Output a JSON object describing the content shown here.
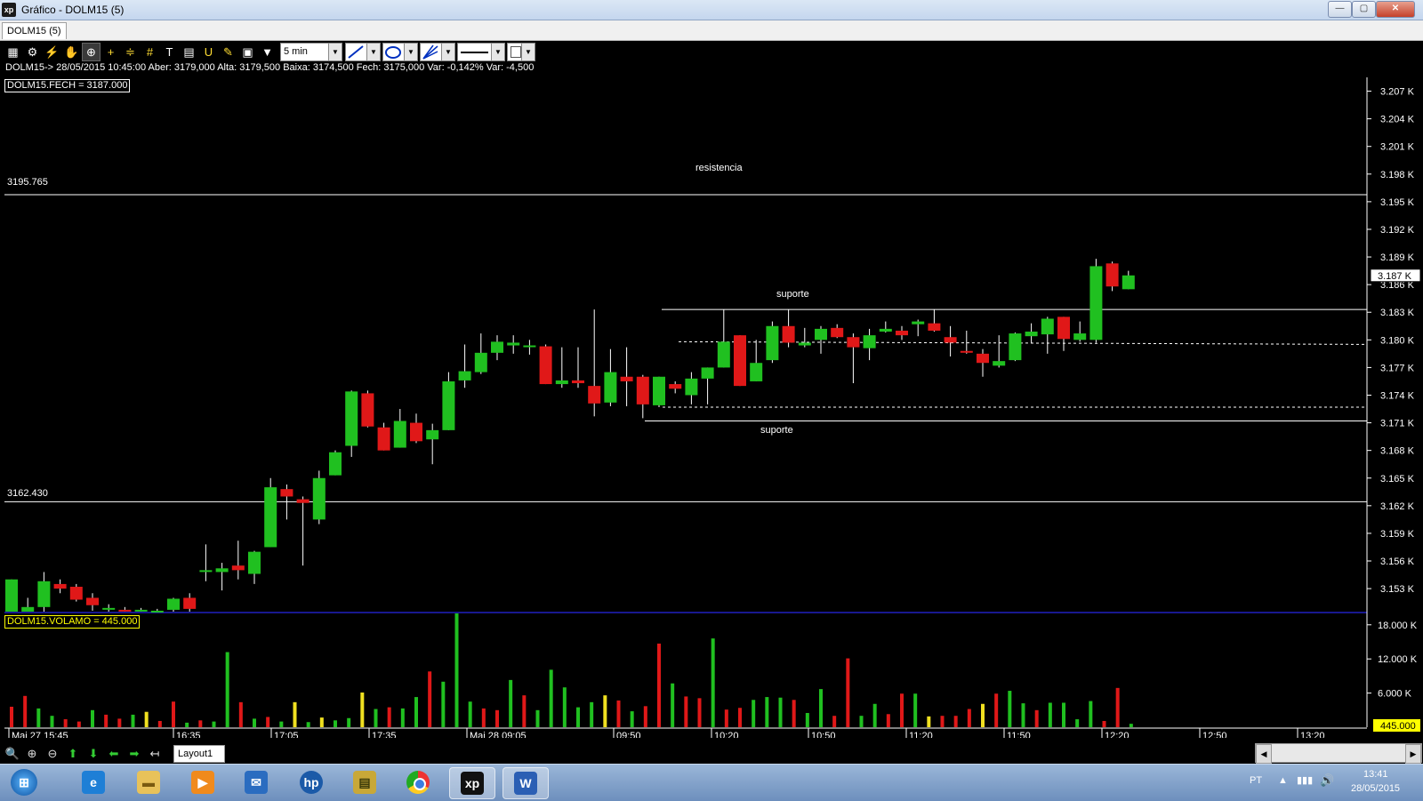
{
  "window": {
    "title": "Gráfico - DOLM15 (5)",
    "app_icon_text": "xp",
    "minimize_label": "—",
    "restore_label": "▢",
    "close_label": "✕"
  },
  "tabs": [
    {
      "label": "DOLM15 (5)"
    }
  ],
  "toolbar": {
    "timeframe": "5 min",
    "icons": [
      "chart-type-icon",
      "settings-gear-icon",
      "indicator-icon",
      "hand-pan-icon",
      "crosshair-icon",
      "cursor-icon",
      "fibonacci-icon",
      "grid-icon",
      "text-tool-icon",
      "calculator-icon",
      "magnet-icon",
      "order-icon",
      "clipboard-icon",
      "filter-icon"
    ]
  },
  "info_line": "DOLM15-> 28/05/2015 10:45:00 Aber: 3179,000 Alta: 3179,500 Baixa: 3174,500 Fech: 3175,000 Var: -0,142% Var: -4,500",
  "price_legend": "DOLM15.FECH = 3187.000",
  "volume_legend": "DOLM15.VOLAMO = 445.000",
  "annotations": {
    "resistencia": "resistencia",
    "suporte_upper": "suporte",
    "suporte_lower": "suporte",
    "level_high": "3195.765",
    "level_low": "3162.430"
  },
  "price_axis": {
    "ticks": [
      "3.207 K",
      "3.204 K",
      "3.201 K",
      "3.198 K",
      "3.195 K",
      "3.192 K",
      "3.189 K",
      "3.186 K",
      "3.183 K",
      "3.180 K",
      "3.177 K",
      "3.174 K",
      "3.171 K",
      "3.168 K",
      "3.165 K",
      "3.162 K",
      "3.159 K",
      "3.156 K",
      "3.153 K"
    ],
    "current": "3.187 K"
  },
  "volume_axis": {
    "ticks": [
      "18.000 K",
      "12.000 K",
      "6.000 K"
    ],
    "current": "445.000"
  },
  "time_axis": [
    "Mai 27 15:45",
    "16:35",
    "17:05",
    "17:35",
    "Mai 28 09:05",
    "09:50",
    "10:20",
    "10:50",
    "11:20",
    "11:50",
    "12:20",
    "12:50",
    "13:20"
  ],
  "chart_data": {
    "type": "candlestick",
    "symbol": "DOLM15",
    "timeframe": "5 min",
    "price_range": [
      3150.5,
      3208.5
    ],
    "volume_range": [
      0,
      20000
    ],
    "horizontal_lines": [
      {
        "label": "resistencia",
        "price": 3195.765
      },
      {
        "label": "suporte",
        "price": 3183.3
      },
      {
        "label": "suporte",
        "price": 3171.2
      },
      {
        "label": "",
        "price": 3162.43
      }
    ],
    "dotted_lines": [
      3179.8,
      3172.7
    ],
    "candles": [
      {
        "o": 3150.5,
        "h": 3154.0,
        "l": 3150.5,
        "c": 3154.0
      },
      {
        "o": 3150.5,
        "h": 3152.0,
        "l": 3150.5,
        "c": 3151.0
      },
      {
        "o": 3151.0,
        "h": 3154.8,
        "l": 3150.5,
        "c": 3153.8
      },
      {
        "o": 3153.5,
        "h": 3154.0,
        "l": 3152.5,
        "c": 3153.0
      },
      {
        "o": 3153.2,
        "h": 3153.5,
        "l": 3151.6,
        "c": 3151.8
      },
      {
        "o": 3152.0,
        "h": 3152.5,
        "l": 3150.6,
        "c": 3151.2
      },
      {
        "o": 3150.8,
        "h": 3151.3,
        "l": 3150.5,
        "c": 3150.9
      },
      {
        "o": 3150.7,
        "h": 3151.0,
        "l": 3150.5,
        "c": 3150.6
      },
      {
        "o": 3150.6,
        "h": 3150.9,
        "l": 3150.5,
        "c": 3150.7
      },
      {
        "o": 3150.6,
        "h": 3150.8,
        "l": 3150.5,
        "c": 3150.6
      },
      {
        "o": 3150.7,
        "h": 3152.0,
        "l": 3150.5,
        "c": 3151.9
      },
      {
        "o": 3152.0,
        "h": 3152.5,
        "l": 3150.5,
        "c": 3150.8
      },
      {
        "o": 3155.0,
        "h": 3157.8,
        "l": 3153.8,
        "c": 3155.0
      },
      {
        "o": 3154.8,
        "h": 3155.8,
        "l": 3152.8,
        "c": 3155.2
      },
      {
        "o": 3155.5,
        "h": 3158.2,
        "l": 3154.0,
        "c": 3155.0
      },
      {
        "o": 3154.6,
        "h": 3157.1,
        "l": 3153.5,
        "c": 3157.0
      },
      {
        "o": 3157.5,
        "h": 3165.0,
        "l": 3157.5,
        "c": 3164.0
      },
      {
        "o": 3163.8,
        "h": 3164.3,
        "l": 3160.5,
        "c": 3163.0
      },
      {
        "o": 3162.7,
        "h": 3163.0,
        "l": 3155.5,
        "c": 3162.3
      },
      {
        "o": 3160.5,
        "h": 3165.8,
        "l": 3160.0,
        "c": 3165.0
      },
      {
        "o": 3165.3,
        "h": 3168.0,
        "l": 3165.3,
        "c": 3167.8
      },
      {
        "o": 3168.5,
        "h": 3174.5,
        "l": 3167.3,
        "c": 3174.4
      },
      {
        "o": 3174.2,
        "h": 3174.5,
        "l": 3170.5,
        "c": 3170.6
      },
      {
        "o": 3170.5,
        "h": 3171.0,
        "l": 3168.0,
        "c": 3168.0
      },
      {
        "o": 3168.3,
        "h": 3172.5,
        "l": 3168.3,
        "c": 3171.2
      },
      {
        "o": 3171.0,
        "h": 3172.0,
        "l": 3168.8,
        "c": 3169.0
      },
      {
        "o": 3169.2,
        "h": 3170.9,
        "l": 3166.5,
        "c": 3170.2
      },
      {
        "o": 3170.2,
        "h": 3176.5,
        "l": 3170.2,
        "c": 3175.5
      },
      {
        "o": 3175.6,
        "h": 3179.5,
        "l": 3174.8,
        "c": 3176.6
      },
      {
        "o": 3176.5,
        "h": 3180.7,
        "l": 3176.3,
        "c": 3178.6
      },
      {
        "o": 3178.6,
        "h": 3180.5,
        "l": 3177.8,
        "c": 3179.8
      },
      {
        "o": 3179.4,
        "h": 3180.5,
        "l": 3178.5,
        "c": 3179.7
      },
      {
        "o": 3179.3,
        "h": 3180.0,
        "l": 3178.4,
        "c": 3179.4
      },
      {
        "o": 3179.3,
        "h": 3179.5,
        "l": 3175.2,
        "c": 3175.2
      },
      {
        "o": 3175.2,
        "h": 3179.2,
        "l": 3174.8,
        "c": 3175.6
      },
      {
        "o": 3175.6,
        "h": 3179.2,
        "l": 3174.8,
        "c": 3175.3
      },
      {
        "o": 3175.0,
        "h": 3183.3,
        "l": 3171.7,
        "c": 3173.1
      },
      {
        "o": 3173.2,
        "h": 3179.0,
        "l": 3172.8,
        "c": 3176.5
      },
      {
        "o": 3176.0,
        "h": 3179.2,
        "l": 3172.8,
        "c": 3175.5
      },
      {
        "o": 3176.0,
        "h": 3176.2,
        "l": 3171.5,
        "c": 3173.0
      },
      {
        "o": 3172.9,
        "h": 3176.0,
        "l": 3172.7,
        "c": 3176.0
      },
      {
        "o": 3175.2,
        "h": 3175.5,
        "l": 3174.2,
        "c": 3174.7
      },
      {
        "o": 3174.0,
        "h": 3176.5,
        "l": 3173.0,
        "c": 3175.8
      },
      {
        "o": 3175.8,
        "h": 3177.0,
        "l": 3173.0,
        "c": 3177.0
      },
      {
        "o": 3177.0,
        "h": 3183.3,
        "l": 3177.0,
        "c": 3179.8
      },
      {
        "o": 3180.5,
        "h": 3180.5,
        "l": 3175.0,
        "c": 3175.0
      },
      {
        "o": 3175.5,
        "h": 3180.0,
        "l": 3175.5,
        "c": 3177.5
      },
      {
        "o": 3177.8,
        "h": 3182.0,
        "l": 3177.5,
        "c": 3181.5
      },
      {
        "o": 3181.5,
        "h": 3183.3,
        "l": 3179.2,
        "c": 3179.7
      },
      {
        "o": 3179.4,
        "h": 3181.3,
        "l": 3179.2,
        "c": 3179.7
      },
      {
        "o": 3180.0,
        "h": 3181.5,
        "l": 3178.5,
        "c": 3181.2
      },
      {
        "o": 3181.3,
        "h": 3181.7,
        "l": 3180.2,
        "c": 3180.3
      },
      {
        "o": 3180.3,
        "h": 3180.7,
        "l": 3175.3,
        "c": 3179.2
      },
      {
        "o": 3179.1,
        "h": 3181.2,
        "l": 3177.8,
        "c": 3180.5
      },
      {
        "o": 3180.9,
        "h": 3182.0,
        "l": 3180.8,
        "c": 3181.2
      },
      {
        "o": 3181.0,
        "h": 3181.5,
        "l": 3180.0,
        "c": 3180.5
      },
      {
        "o": 3181.7,
        "h": 3182.2,
        "l": 3180.4,
        "c": 3182.0
      },
      {
        "o": 3181.8,
        "h": 3183.3,
        "l": 3180.9,
        "c": 3181.0
      },
      {
        "o": 3180.3,
        "h": 3181.5,
        "l": 3178.2,
        "c": 3179.7
      },
      {
        "o": 3178.8,
        "h": 3181.0,
        "l": 3178.5,
        "c": 3178.7
      },
      {
        "o": 3178.5,
        "h": 3179.0,
        "l": 3176.0,
        "c": 3177.5
      },
      {
        "o": 3177.2,
        "h": 3180.5,
        "l": 3177.0,
        "c": 3177.7
      },
      {
        "o": 3177.8,
        "h": 3180.8,
        "l": 3177.7,
        "c": 3180.7
      },
      {
        "o": 3180.4,
        "h": 3181.8,
        "l": 3179.6,
        "c": 3180.9
      },
      {
        "o": 3180.6,
        "h": 3182.5,
        "l": 3178.5,
        "c": 3182.3
      },
      {
        "o": 3182.5,
        "h": 3182.5,
        "l": 3178.8,
        "c": 3180.1
      },
      {
        "o": 3180.0,
        "h": 3182.0,
        "l": 3179.8,
        "c": 3180.7
      },
      {
        "o": 3180.0,
        "h": 3188.8,
        "l": 3179.7,
        "c": 3188.0
      },
      {
        "o": 3188.3,
        "h": 3188.5,
        "l": 3185.3,
        "c": 3185.8
      },
      {
        "o": 3185.5,
        "h": 3187.5,
        "l": 3185.5,
        "c": 3187.0
      }
    ],
    "volumes": [
      {
        "v": 3600,
        "col": "red"
      },
      {
        "v": 5500,
        "col": "red"
      },
      {
        "v": 3300,
        "col": "green"
      },
      {
        "v": 2000,
        "col": "green"
      },
      {
        "v": 1400,
        "col": "red"
      },
      {
        "v": 1000,
        "col": "red"
      },
      {
        "v": 3000,
        "col": "green"
      },
      {
        "v": 2200,
        "col": "red"
      },
      {
        "v": 1500,
        "col": "red"
      },
      {
        "v": 2200,
        "col": "green"
      },
      {
        "v": 2700,
        "col": "yellow"
      },
      {
        "v": 1100,
        "col": "red"
      },
      {
        "v": 4500,
        "col": "red"
      },
      {
        "v": 800,
        "col": "green"
      },
      {
        "v": 1200,
        "col": "red"
      },
      {
        "v": 1000,
        "col": "green"
      },
      {
        "v": 13200,
        "col": "green"
      },
      {
        "v": 4400,
        "col": "red"
      },
      {
        "v": 1500,
        "col": "green"
      },
      {
        "v": 1800,
        "col": "red"
      },
      {
        "v": 1000,
        "col": "green"
      },
      {
        "v": 4400,
        "col": "yellow"
      },
      {
        "v": 900,
        "col": "green"
      },
      {
        "v": 1700,
        "col": "yellow"
      },
      {
        "v": 1200,
        "col": "green"
      },
      {
        "v": 1600,
        "col": "green"
      },
      {
        "v": 6100,
        "col": "yellow"
      },
      {
        "v": 3200,
        "col": "green"
      },
      {
        "v": 3500,
        "col": "red"
      },
      {
        "v": 3300,
        "col": "green"
      },
      {
        "v": 5300,
        "col": "green"
      },
      {
        "v": 9800,
        "col": "red"
      },
      {
        "v": 8000,
        "col": "green"
      },
      {
        "v": 20000,
        "col": "green"
      },
      {
        "v": 4500,
        "col": "green"
      },
      {
        "v": 3300,
        "col": "red"
      },
      {
        "v": 3000,
        "col": "red"
      },
      {
        "v": 8300,
        "col": "green"
      },
      {
        "v": 5600,
        "col": "red"
      },
      {
        "v": 3000,
        "col": "green"
      },
      {
        "v": 10100,
        "col": "green"
      },
      {
        "v": 7000,
        "col": "green"
      },
      {
        "v": 3500,
        "col": "green"
      },
      {
        "v": 4400,
        "col": "green"
      },
      {
        "v": 5600,
        "col": "yellow"
      },
      {
        "v": 4700,
        "col": "red"
      },
      {
        "v": 2800,
        "col": "green"
      },
      {
        "v": 3700,
        "col": "red"
      },
      {
        "v": 14700,
        "col": "red"
      },
      {
        "v": 7700,
        "col": "green"
      },
      {
        "v": 5400,
        "col": "red"
      },
      {
        "v": 5100,
        "col": "red"
      },
      {
        "v": 15600,
        "col": "green"
      },
      {
        "v": 3100,
        "col": "red"
      },
      {
        "v": 3400,
        "col": "red"
      },
      {
        "v": 4800,
        "col": "green"
      },
      {
        "v": 5300,
        "col": "green"
      },
      {
        "v": 5200,
        "col": "green"
      },
      {
        "v": 4800,
        "col": "red"
      },
      {
        "v": 2500,
        "col": "green"
      },
      {
        "v": 6700,
        "col": "green"
      },
      {
        "v": 2000,
        "col": "red"
      },
      {
        "v": 12100,
        "col": "red"
      },
      {
        "v": 2000,
        "col": "green"
      },
      {
        "v": 4100,
        "col": "green"
      },
      {
        "v": 2300,
        "col": "red"
      },
      {
        "v": 5900,
        "col": "red"
      },
      {
        "v": 5900,
        "col": "green"
      },
      {
        "v": 1900,
        "col": "yellow"
      },
      {
        "v": 2000,
        "col": "red"
      },
      {
        "v": 2000,
        "col": "red"
      },
      {
        "v": 3200,
        "col": "red"
      },
      {
        "v": 4100,
        "col": "yellow"
      },
      {
        "v": 5900,
        "col": "red"
      },
      {
        "v": 6400,
        "col": "green"
      },
      {
        "v": 4200,
        "col": "green"
      },
      {
        "v": 3000,
        "col": "red"
      },
      {
        "v": 4300,
        "col": "green"
      },
      {
        "v": 4300,
        "col": "green"
      },
      {
        "v": 1400,
        "col": "green"
      },
      {
        "v": 4600,
        "col": "green"
      },
      {
        "v": 1100,
        "col": "red"
      },
      {
        "v": 6900,
        "col": "red"
      },
      {
        "v": 600,
        "col": "green"
      }
    ]
  },
  "nav": {
    "layout_tab": "Layout1"
  },
  "taskbar": {
    "language": "PT",
    "time": "13:41",
    "date": "28/05/2015",
    "apps": [
      "windows-start-icon",
      "internet-explorer-icon",
      "file-explorer-icon",
      "media-player-icon",
      "outlook-icon",
      "hp-icon",
      "archive-icon",
      "chrome-icon",
      "xp-broker-icon",
      "word-icon"
    ],
    "xp_label": "xp",
    "word_label": "W"
  },
  "colors": {
    "up": "#20c020",
    "down": "#e01818",
    "volume_yellow": "#f0e020",
    "separator": "#2020c0"
  }
}
